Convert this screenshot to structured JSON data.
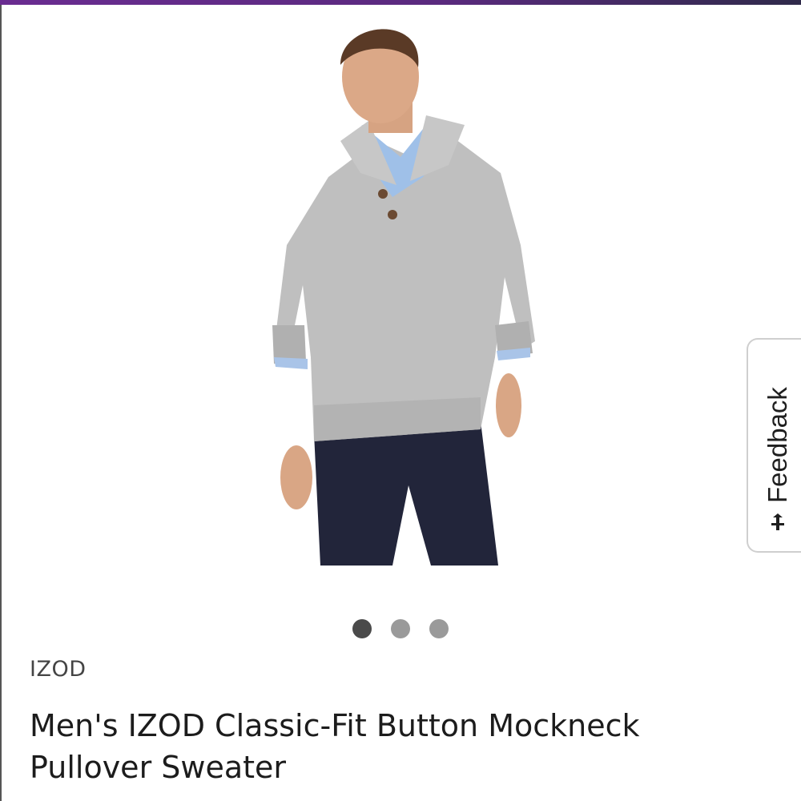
{
  "product": {
    "brand": "IZOD",
    "title": "Men's IZOD Classic-Fit Button Mockneck Pullover Sweater",
    "image_alt": "Men's IZOD Classic-Fit Button Mockneck Pullover Sweater",
    "image_count": 3,
    "active_image": 1
  },
  "feedback": {
    "label": "Feedback",
    "icon": "feedback-icon"
  },
  "colors": {
    "accent_bar_start": "#6a2c91",
    "accent_bar_end": "#2f2a4a",
    "dot_active": "#4a4a4a",
    "dot_inactive": "#9a9a9a"
  }
}
